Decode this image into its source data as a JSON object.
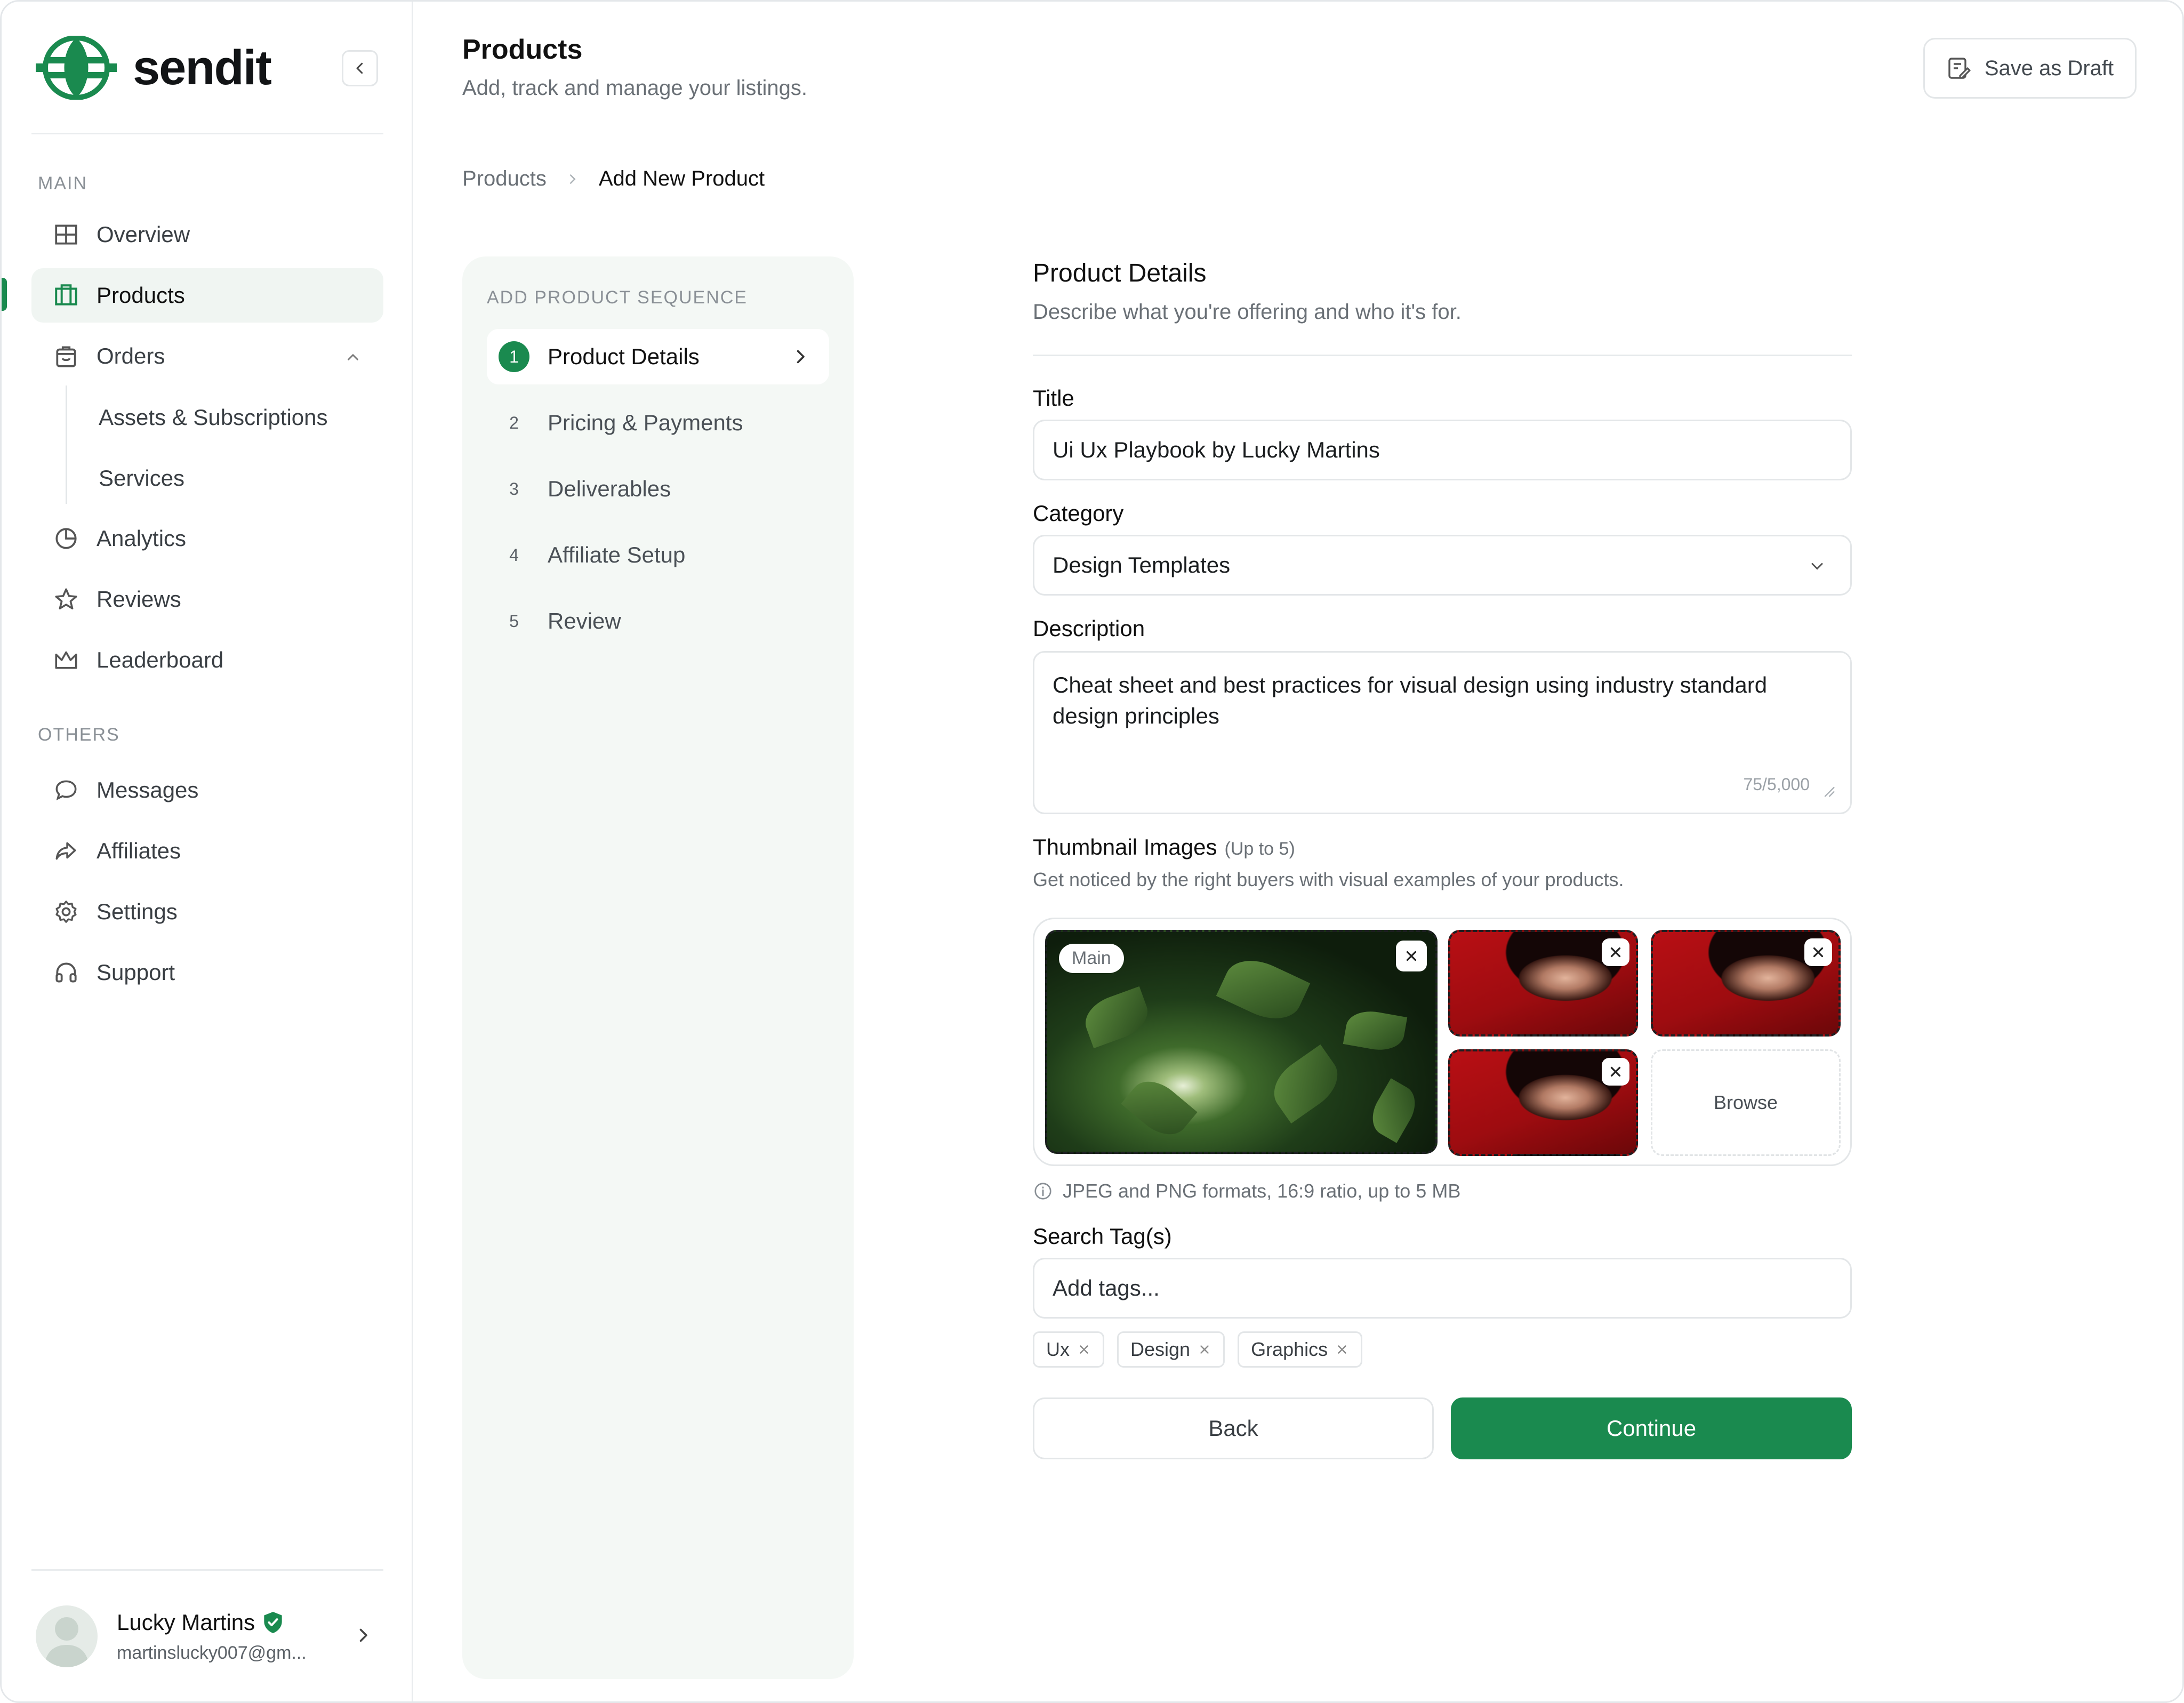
{
  "brand": {
    "name": "sendit",
    "accent": "#1a8a4f"
  },
  "sidebar": {
    "main_label": "MAIN",
    "others_label": "OTHERS",
    "items": [
      {
        "label": "Overview",
        "icon": "grid-icon"
      },
      {
        "label": "Products",
        "icon": "box-icon",
        "active": true
      },
      {
        "label": "Orders",
        "icon": "shopping-bag-icon",
        "expanded": true
      },
      {
        "label": "Analytics",
        "icon": "pie-chart-icon"
      },
      {
        "label": "Reviews",
        "icon": "star-icon"
      },
      {
        "label": "Leaderboard",
        "icon": "crown-icon"
      }
    ],
    "order_subitems": [
      "Assets & Subscriptions",
      "Services"
    ],
    "other_items": [
      {
        "label": "Messages",
        "icon": "chat-bubble-icon"
      },
      {
        "label": "Affiliates",
        "icon": "share-arrow-icon"
      },
      {
        "label": "Settings",
        "icon": "gear-icon"
      },
      {
        "label": "Support",
        "icon": "headphones-icon"
      }
    ],
    "user": {
      "name": "Lucky Martins",
      "email": "martinslucky007@gm..."
    }
  },
  "header": {
    "title": "Products",
    "subtitle": "Add, track and manage your listings.",
    "draft_button": "Save as Draft"
  },
  "breadcrumb": [
    "Products",
    "Add New Product"
  ],
  "steps": {
    "label": "ADD PRODUCT SEQUENCE",
    "items": [
      {
        "num": "1",
        "label": "Product Details",
        "active": true
      },
      {
        "num": "2",
        "label": "Pricing & Payments"
      },
      {
        "num": "3",
        "label": "Deliverables"
      },
      {
        "num": "4",
        "label": "Affiliate Setup"
      },
      {
        "num": "5",
        "label": "Review"
      }
    ]
  },
  "form": {
    "heading": "Product Details",
    "subheading": "Describe what you're offering and who it's for.",
    "title_label": "Title",
    "title_value": "Ui Ux Playbook by Lucky Martins",
    "category_label": "Category",
    "category_value": "Design Templates",
    "description_label": "Description",
    "description_value": "Cheat sheet and best practices for visual design using industry standard design principles",
    "description_counter": "75/5,000",
    "thumbnails_label": "Thumbnail Images",
    "thumbnails_hint": "(Up to 5)",
    "thumbnails_sub": "Get noticed by the right buyers with visual examples of your products.",
    "main_badge": "Main",
    "browse_label": "Browse",
    "format_info": "JPEG and PNG formats, 16:9 ratio, up to 5 MB",
    "tags_label": "Search Tag(s)",
    "tags_placeholder": "Add tags...",
    "tags": [
      "Ux",
      "Design",
      "Graphics"
    ],
    "back_button": "Back",
    "continue_button": "Continue"
  }
}
